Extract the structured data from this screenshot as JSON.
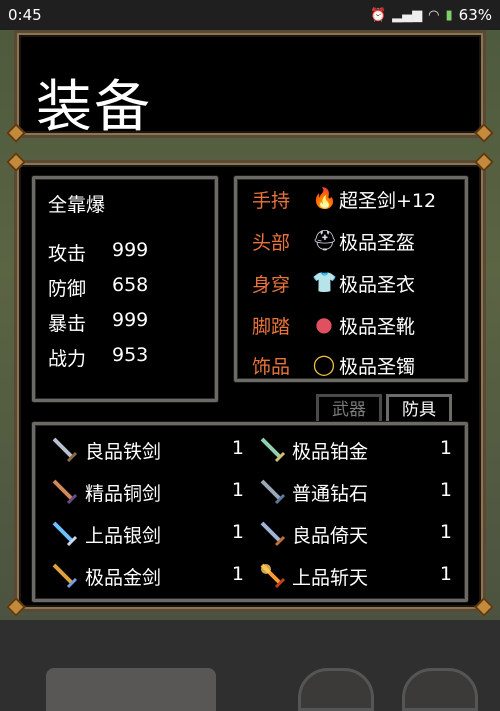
{
  "status_bar": {
    "time": "0:45",
    "battery": "63%"
  },
  "header": {
    "title": "装备"
  },
  "stats": {
    "name": "全靠爆",
    "rows": [
      {
        "label": "攻击",
        "value": "999"
      },
      {
        "label": "防御",
        "value": "658"
      },
      {
        "label": "暴击",
        "value": "999"
      },
      {
        "label": "战力",
        "value": "953"
      }
    ]
  },
  "slots": [
    {
      "label": "手持",
      "item": "超圣剑+12",
      "icon": "flame-sword-icon"
    },
    {
      "label": "头部",
      "item": "极品圣盔",
      "icon": "helmet-icon"
    },
    {
      "label": "身穿",
      "item": "极品圣衣",
      "icon": "armor-icon"
    },
    {
      "label": "脚踏",
      "item": "极品圣靴",
      "icon": "boots-icon"
    },
    {
      "label": "饰品",
      "item": "极品圣镯",
      "icon": "bracelet-icon"
    }
  ],
  "tabs": {
    "weapon": "武器",
    "armor": "防具"
  },
  "inventory": [
    {
      "name": "良品铁剑",
      "qty": "1",
      "color": "#b8c0d0"
    },
    {
      "name": "极品铂金",
      "qty": "1",
      "color": "#8fd0b0"
    },
    {
      "name": "精品铜剑",
      "qty": "1",
      "color": "#d08a5a"
    },
    {
      "name": "普通钻石",
      "qty": "1",
      "color": "#9aa8b8"
    },
    {
      "name": "上品银剑",
      "qty": "1",
      "color": "#6fc0ff"
    },
    {
      "name": "良品倚天",
      "qty": "1",
      "color": "#a0b4d8"
    },
    {
      "name": "极品金剑",
      "qty": "1",
      "color": "#e0a040"
    },
    {
      "name": "上品斩天",
      "qty": "1",
      "color": "#ff9a30"
    }
  ]
}
